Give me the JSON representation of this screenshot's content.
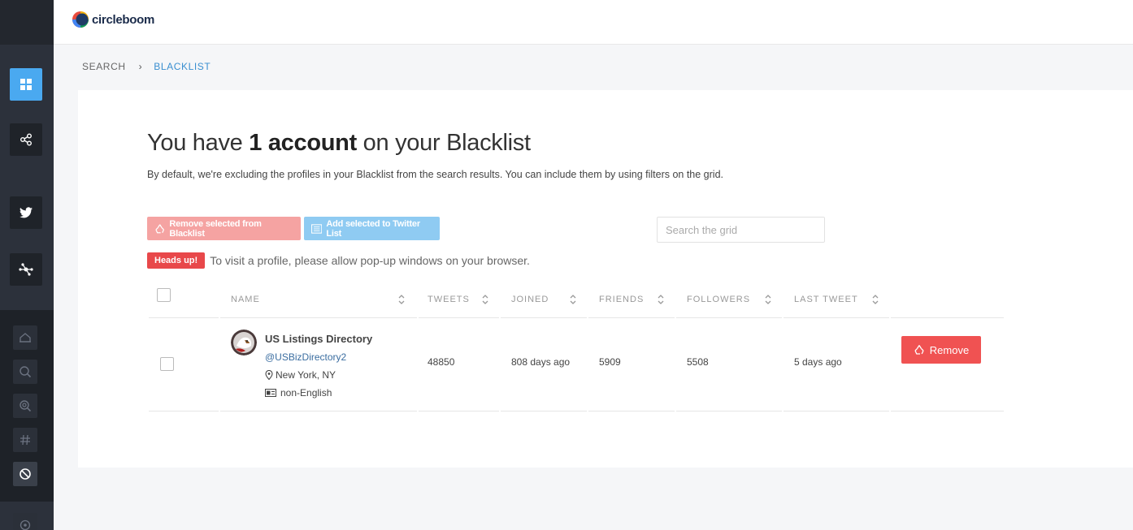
{
  "app": {
    "logo_text": "circleboom"
  },
  "breadcrumb": {
    "search": "SEARCH",
    "current": "BLACKLIST"
  },
  "page": {
    "title_prefix": "You have ",
    "title_count": "1 account",
    "title_suffix": " on your Blacklist",
    "subtitle": "By default, we're excluding the profiles in your Blacklist from the search results. You can include them by using filters on the grid."
  },
  "actions": {
    "remove_selected_label": "Remove selected from Blacklist",
    "add_selected_label": "Add selected to Twitter List",
    "search_placeholder": "Search the grid"
  },
  "notice": {
    "badge": "Heads up!",
    "text": "To visit a profile, please allow pop-up windows on your browser."
  },
  "table": {
    "columns": {
      "name": "NAME",
      "tweets": "TWEETS",
      "joined": "JOINED",
      "friends": "FRIENDS",
      "followers": "FOLLOWERS",
      "last_tweet": "LAST TWEET"
    },
    "rows": [
      {
        "name": "US Listings Directory",
        "handle": "@USBizDirectory2",
        "location": "New York, NY",
        "language": "non-English",
        "tweets": "48850",
        "joined": "808 days ago",
        "friends": "5909",
        "followers": "5508",
        "last_tweet": "5 days ago",
        "action_label": "Remove"
      }
    ]
  },
  "colors": {
    "sidebar_bg": "#2a2f38",
    "active_accent": "#4aa9f0",
    "breadcrumb_active": "#3a8fd0",
    "remove_red": "#f05252",
    "badge_red": "#e8484a"
  },
  "sidebar_icons": [
    "dashboard-icon",
    "share-icon",
    "twitter-icon",
    "network-icon",
    "home-icon",
    "search-icon",
    "zoom-search-icon",
    "hashtag-icon",
    "blacklist-icon",
    "location-icon"
  ]
}
